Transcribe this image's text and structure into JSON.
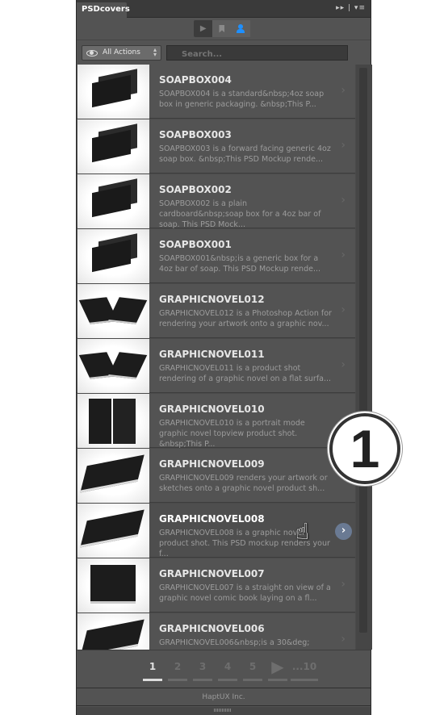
{
  "panel": {
    "tab_label": "PSDcovers",
    "tab_controls": "▸▸ | ▾≡"
  },
  "toolbar": {
    "buttons": [
      {
        "icon": "play-icon",
        "glyph": "▶"
      },
      {
        "icon": "bookmark-icon",
        "glyph": "❚"
      },
      {
        "icon": "user-icon",
        "glyph": "👤",
        "active": true
      }
    ]
  },
  "filter": {
    "selected": "All Actions",
    "search_placeholder": "Search..."
  },
  "items": [
    {
      "title": "SOAPBOX004",
      "desc": "SOAPBOX004 is a standard&nbsp;4oz soap box in generic packaging. &nbsp;This P...",
      "kind": "box"
    },
    {
      "title": "SOAPBOX003",
      "desc": "SOAPBOX003 is a forward facing generic 4oz soap box. &nbsp;This PSD Mockup rende...",
      "kind": "box"
    },
    {
      "title": "SOAPBOX002",
      "desc": "SOAPBOX002 is a plain cardboard&nbsp;soap box for a 4oz bar of soap. This PSD Mock...",
      "kind": "box"
    },
    {
      "title": "SOAPBOX001",
      "desc": "SOAPBOX001&nbsp;is a generic box for a 4oz bar of soap. This PSD Mockup rende...",
      "kind": "box"
    },
    {
      "title": "GRAPHICNOVEL012",
      "desc": "GRAPHICNOVEL012 is a Photoshop Action for rendering your artwork onto a graphic nov...",
      "kind": "open-book"
    },
    {
      "title": "GRAPHICNOVEL011",
      "desc": "GRAPHICNOVEL011 is a product shot rendering of a graphic novel on a flat surfa...",
      "kind": "open-book"
    },
    {
      "title": "GRAPHICNOVEL010",
      "desc": "GRAPHICNOVEL010 is a portrait mode graphic novel topview product shot. &nbsp;This P...",
      "kind": "standing-book"
    },
    {
      "title": "GRAPHICNOVEL009",
      "desc": "GRAPHICNOVEL009 renders your artwork or sketches onto a graphic novel product sh...",
      "kind": "closed-book"
    },
    {
      "title": "GRAPHICNOVEL008",
      "desc": "GRAPHICNOVEL008 is a graphic novel product shot. This PSD mockup renders your f...",
      "kind": "closed-book",
      "hover": true
    },
    {
      "title": "GRAPHICNOVEL007",
      "desc": "GRAPHICNOVEL007 is a straight on view of a graphic novel comic book laying on a fl...",
      "kind": "flat-book"
    },
    {
      "title": "GRAPHICNOVEL006",
      "desc": "GRAPHICNOVEL006&nbsp;is a 30&deg;",
      "kind": "closed-book"
    }
  ],
  "pagination": {
    "pages": [
      "1",
      "2",
      "3",
      "4",
      "5"
    ],
    "current": "1",
    "next_glyph": "▶",
    "last": "...10"
  },
  "footer": {
    "text": "HaptUX Inc."
  },
  "callout": {
    "number": "1"
  },
  "colors": {
    "panel": "#535353",
    "accent": "#1e90ff",
    "hover_chevron": "#6a7a93"
  }
}
